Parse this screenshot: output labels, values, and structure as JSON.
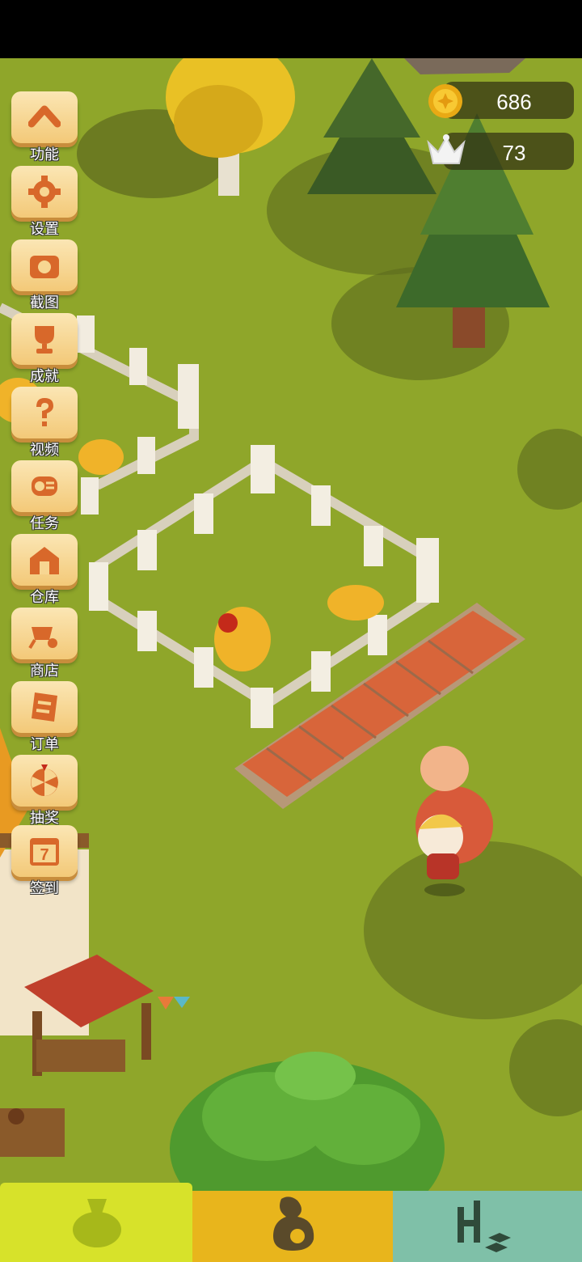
{
  "hud": {
    "coins": "686",
    "crowns": "73"
  },
  "menu": [
    {
      "label": "功能",
      "icon": "chevron-up-icon"
    },
    {
      "label": "设置",
      "icon": "gear-icon"
    },
    {
      "label": "截图",
      "icon": "camera-icon"
    },
    {
      "label": "成就",
      "icon": "trophy-icon"
    },
    {
      "label": "视频",
      "icon": "question-icon"
    },
    {
      "label": "任务",
      "icon": "scroll-icon"
    },
    {
      "label": "仓库",
      "icon": "barn-icon"
    },
    {
      "label": "商店",
      "icon": "wheelbarrow-icon"
    },
    {
      "label": "订单",
      "icon": "order-icon"
    },
    {
      "label": "抽奖",
      "icon": "wheel-icon"
    },
    {
      "label": "签到",
      "icon": "calendar-icon"
    }
  ],
  "calendar_day": "7",
  "tabs": [
    {
      "name": "sack-tab",
      "color": "#d7e22a"
    },
    {
      "name": "chicken-tab",
      "color": "#e8b51c"
    },
    {
      "name": "build-tab",
      "color": "#7fc0a8"
    }
  ]
}
